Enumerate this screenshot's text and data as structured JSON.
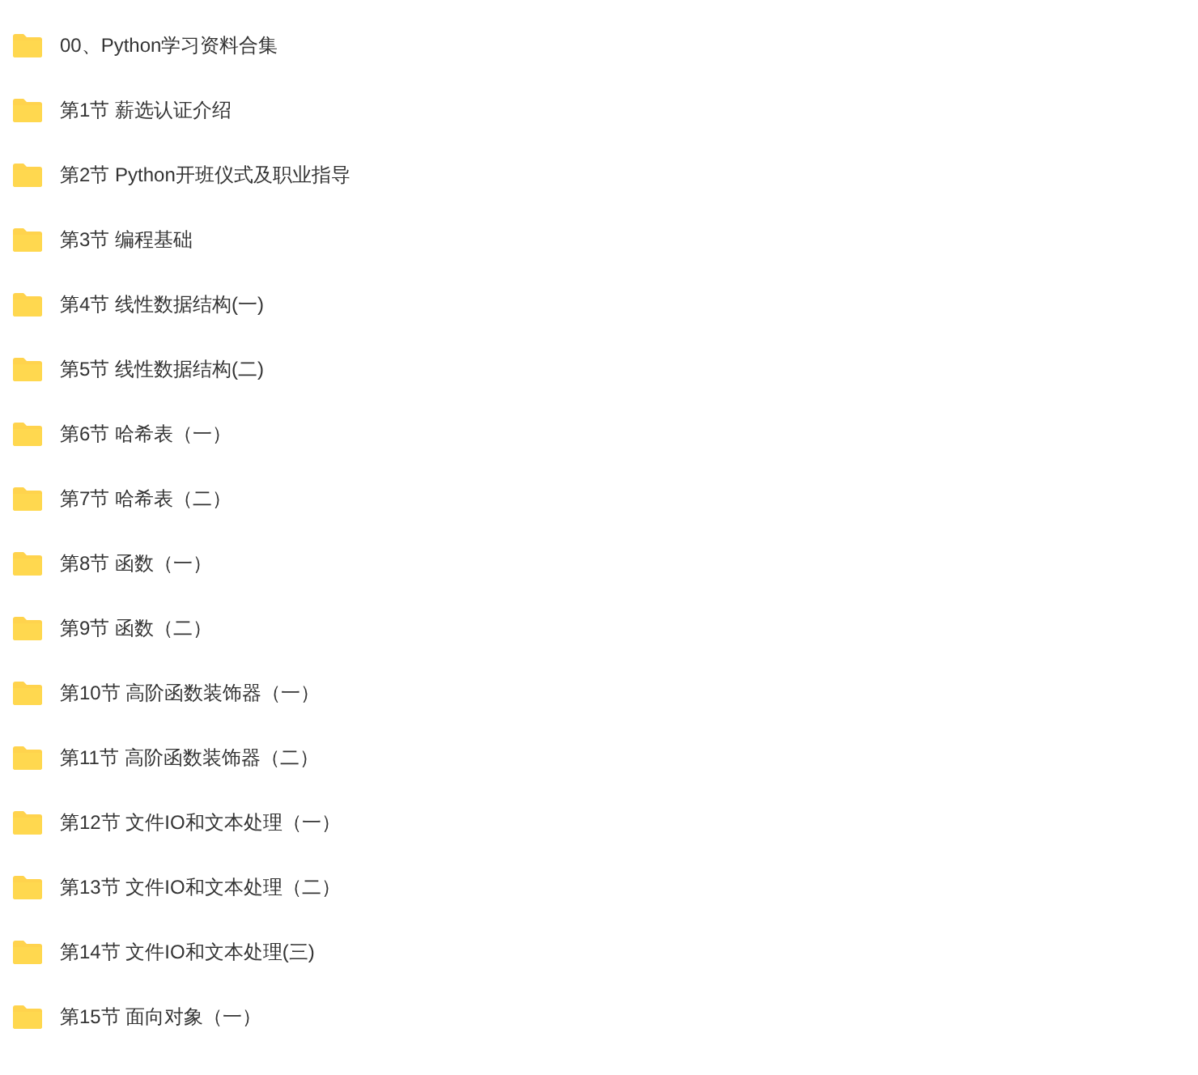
{
  "folders": [
    {
      "name": "00、Python学习资料合集"
    },
    {
      "name": "第1节 薪选认证介绍"
    },
    {
      "name": "第2节 Python开班仪式及职业指导"
    },
    {
      "name": "第3节 编程基础"
    },
    {
      "name": "第4节 线性数据结构(一)"
    },
    {
      "name": "第5节 线性数据结构(二)"
    },
    {
      "name": "第6节 哈希表（一）"
    },
    {
      "name": "第7节 哈希表（二）"
    },
    {
      "name": "第8节 函数（一）"
    },
    {
      "name": "第9节 函数（二）"
    },
    {
      "name": "第10节 高阶函数装饰器（一）"
    },
    {
      "name": "第11节 高阶函数装饰器（二）"
    },
    {
      "name": "第12节 文件IO和文本处理（一）"
    },
    {
      "name": "第13节 文件IO和文本处理（二）"
    },
    {
      "name": "第14节 文件IO和文本处理(三)"
    },
    {
      "name": "第15节 面向对象（一）"
    }
  ]
}
